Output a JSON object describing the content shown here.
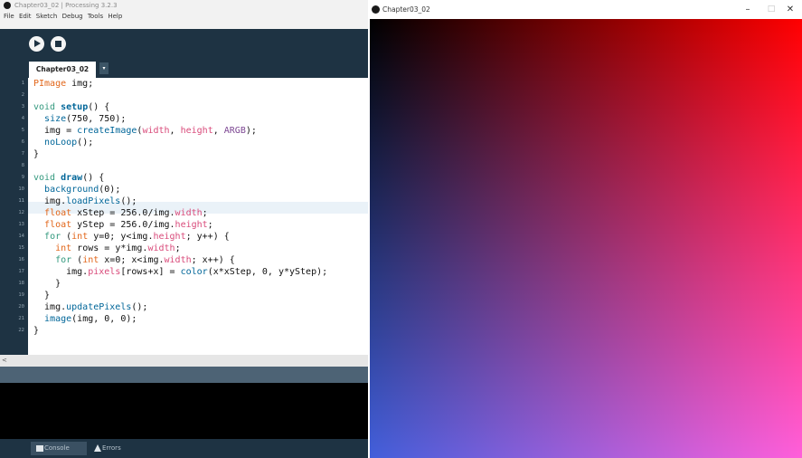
{
  "ide": {
    "window_title": "Chapter03_02 | Processing 3.2.3",
    "menu": [
      "File",
      "Edit",
      "Sketch",
      "Debug",
      "Tools",
      "Help"
    ],
    "tab_name": "Chapter03_02",
    "tab_menu_icon": "dropdown-arrow-icon",
    "toolbar": {
      "run_icon": "play-icon",
      "stop_icon": "stop-icon"
    },
    "line_numbers": [
      "1",
      "2",
      "3",
      "4",
      "5",
      "6",
      "7",
      "8",
      "9",
      "10",
      "11",
      "12",
      "13",
      "14",
      "15",
      "16",
      "17",
      "18",
      "19",
      "20",
      "21",
      "22"
    ],
    "highlighted_line": 11,
    "scroll_left_arrow": "<",
    "bottom_tabs": [
      {
        "label": "Console",
        "icon": "console-icon"
      },
      {
        "label": "Errors",
        "icon": "warning-icon"
      }
    ]
  },
  "code": {
    "l1": [
      "PImage",
      " img;"
    ],
    "l3": [
      "void",
      " ",
      "setup",
      "() {"
    ],
    "l4": [
      "  ",
      "size",
      "(750, 750);"
    ],
    "l5": [
      "  img = ",
      "createImage",
      "(",
      "width",
      ", ",
      "height",
      ", ",
      "ARGB",
      ");"
    ],
    "l6": [
      "  ",
      "noLoop",
      "();"
    ],
    "l7": "}",
    "l9": [
      "void",
      " ",
      "draw",
      "() {"
    ],
    "l10": [
      "  ",
      "background",
      "(0);"
    ],
    "l11": [
      "  img.",
      "loadPixels",
      "();"
    ],
    "l12": [
      "  ",
      "float",
      " xStep = 256.0/img.",
      "width",
      ";"
    ],
    "l13": [
      "  ",
      "float",
      " yStep = 256.0/img.",
      "height",
      ";"
    ],
    "l14": [
      "  ",
      "for",
      " (",
      "int",
      " y=0; y<img.",
      "height",
      "; y++) {"
    ],
    "l15": [
      "    ",
      "int",
      " rows = y*img.",
      "width",
      ";"
    ],
    "l16": [
      "    ",
      "for",
      " (",
      "int",
      " x=0; x<img.",
      "width",
      "; x++) {"
    ],
    "l17": [
      "      img.",
      "pixels",
      "[rows+x] = ",
      "color",
      "(x*xStep, 0, y*yStep);"
    ],
    "l18": "    }",
    "l19": "  }",
    "l20": [
      "  img.",
      "updatePixels",
      "();"
    ],
    "l21": [
      "  ",
      "image",
      "(img, 0, 0);"
    ],
    "l22": "}"
  },
  "sketch": {
    "window_title": "Chapter03_02",
    "controls": {
      "minimize": "–",
      "maximize": "□",
      "close": "✕"
    }
  }
}
